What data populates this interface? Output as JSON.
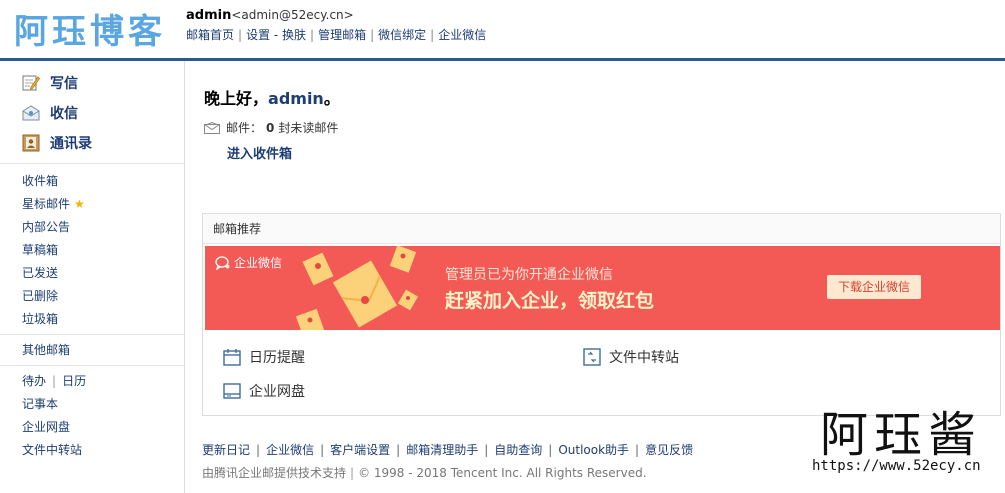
{
  "header": {
    "logo_text": "阿珏博客",
    "user_name": "admin",
    "user_email": "<admin@52ecy.cn>",
    "nav": [
      "邮箱首页",
      "设置 - 换肤",
      "管理邮箱",
      "微信绑定",
      "企业微信"
    ],
    "colors": {
      "accent_bar": "#2d5a8c",
      "logo": "#5aa6e0"
    }
  },
  "sidebar": {
    "primary": [
      {
        "label": "写信",
        "icon": "pencil-icon"
      },
      {
        "label": "收信",
        "icon": "inbox-icon"
      },
      {
        "label": "通讯录",
        "icon": "contacts-icon"
      }
    ],
    "folders": [
      "收件箱",
      "星标邮件",
      "内部公告",
      "草稿箱",
      "已发送",
      "已删除",
      "垃圾箱"
    ],
    "star_glyph": "★",
    "other": "其他邮箱",
    "tools": {
      "todo": "待办",
      "calendar": "日历",
      "notes": "记事本",
      "netdisk": "企业网盘",
      "transfer": "文件中转站"
    }
  },
  "main": {
    "greeting_prefix": "晚上好，",
    "greeting_user": "admin",
    "greeting_suffix": "。",
    "mail_label": "邮件：",
    "unread_count": "0",
    "unread_suffix": "封未读邮件",
    "inbox_link": "进入收件箱",
    "recommend_title": "邮箱推荐",
    "banner": {
      "brand": "企业微信",
      "sub": "管理员已为你开通企业微信",
      "main": "赶紧加入企业，领取红包",
      "button": "下载企业微信",
      "bg_color": "#f45a55"
    },
    "tools": [
      {
        "label": "日历提醒",
        "icon": "calendar-icon"
      },
      {
        "label": "文件中转站",
        "icon": "file-transfer-icon"
      },
      {
        "label": "企业网盘",
        "icon": "netdisk-icon"
      }
    ]
  },
  "footer": {
    "links": [
      "更新日记",
      "企业微信",
      "客户端设置",
      "邮箱清理助手",
      "自助查询",
      "Outlook助手",
      "意见反馈"
    ],
    "provider": "由腾讯企业邮提供技术支持",
    "copyright": "© 1998 - 2018 Tencent Inc. All Rights Reserved."
  },
  "watermark": {
    "name": "阿珏酱",
    "url": "https://www.52ecy.cn"
  }
}
